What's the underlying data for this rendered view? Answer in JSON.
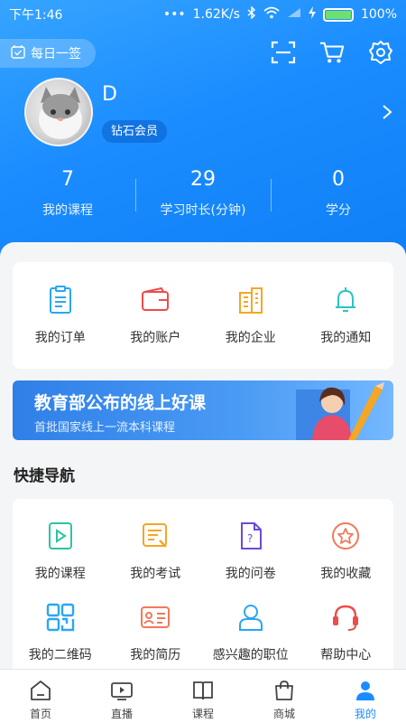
{
  "status_bar": {
    "time": "下午1:46",
    "network": "1.62K/s",
    "battery": "100%"
  },
  "header": {
    "checkin_label": "每日一签",
    "user": {
      "name": "D",
      "member_level": "钻石会员"
    },
    "stats": [
      {
        "value": "7",
        "label": "我的课程"
      },
      {
        "value": "29",
        "label": "学习时长(分钟)"
      },
      {
        "value": "0",
        "label": "学分"
      }
    ]
  },
  "quick_actions": [
    {
      "label": "我的订单",
      "icon": "order-icon"
    },
    {
      "label": "我的账户",
      "icon": "wallet-icon"
    },
    {
      "label": "我的企业",
      "icon": "company-icon"
    },
    {
      "label": "我的通知",
      "icon": "bell-icon"
    }
  ],
  "banner": {
    "title": "教育部公布的线上好课",
    "subtitle": "首批国家线上一流本科课程"
  },
  "quick_nav": {
    "title": "快捷导航",
    "items": [
      {
        "label": "我的课程",
        "icon": "course-play-icon"
      },
      {
        "label": "我的考试",
        "icon": "exam-icon"
      },
      {
        "label": "我的问卷",
        "icon": "survey-icon"
      },
      {
        "label": "我的收藏",
        "icon": "star-icon"
      },
      {
        "label": "我的二维码",
        "icon": "qrcode-icon"
      },
      {
        "label": "我的简历",
        "icon": "resume-icon"
      },
      {
        "label": "感兴趣的职位",
        "icon": "person-icon"
      },
      {
        "label": "帮助中心",
        "icon": "headset-icon"
      }
    ]
  },
  "tab_bar": [
    {
      "label": "首页",
      "icon": "home-icon"
    },
    {
      "label": "直播",
      "icon": "live-icon"
    },
    {
      "label": "课程",
      "icon": "book-icon"
    },
    {
      "label": "商城",
      "icon": "bag-icon"
    },
    {
      "label": "我的",
      "icon": "profile-icon",
      "active": true
    }
  ],
  "colors": {
    "accent": "#1a8cff",
    "orange": "#f5a623",
    "red": "#ef4b4b",
    "purple": "#6b4bd6",
    "teal": "#2bc4c4"
  }
}
